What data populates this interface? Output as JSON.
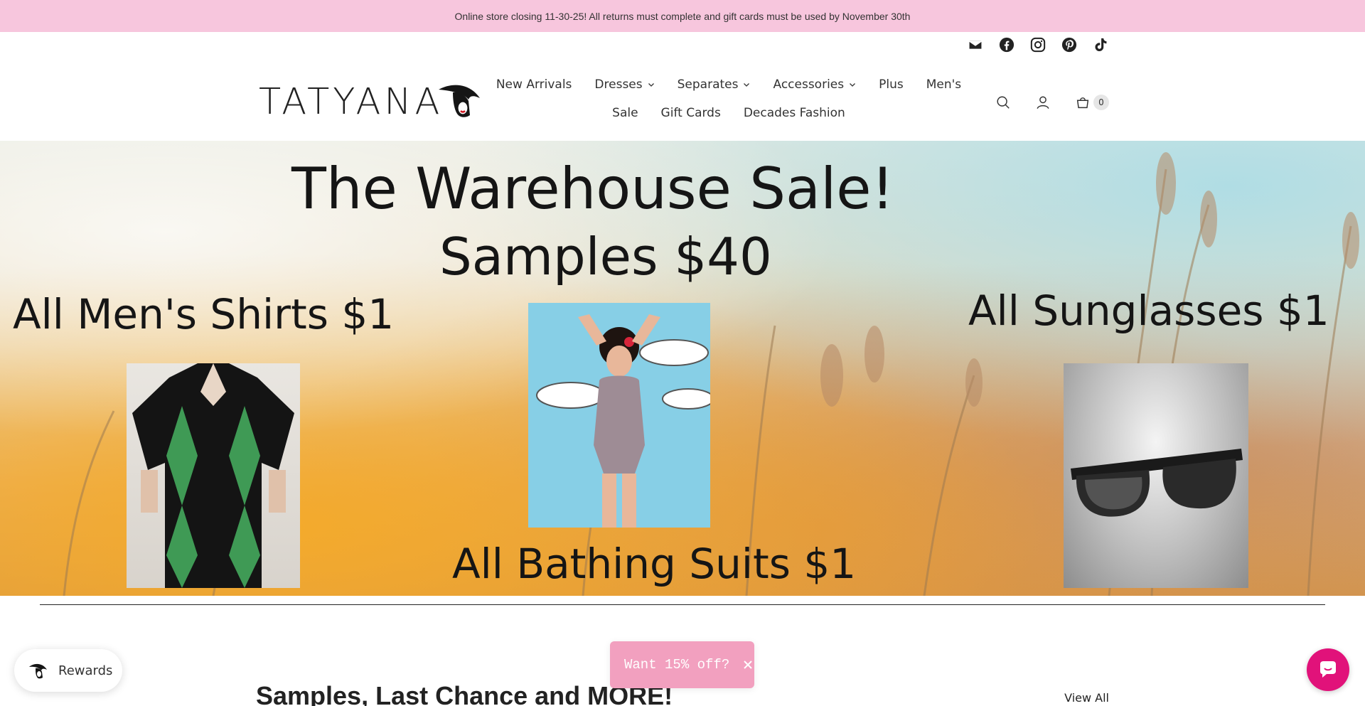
{
  "announcement": {
    "text": "Online store closing 11-30-25! All returns must complete and gift cards must be used by November 30th"
  },
  "social_icons": [
    "mail-icon",
    "facebook-icon",
    "instagram-icon",
    "pinterest-icon",
    "tiktok-icon"
  ],
  "brand": {
    "name": "TATYANA"
  },
  "nav": {
    "row1": [
      {
        "label": "New Arrivals",
        "has_dropdown": false
      },
      {
        "label": "Dresses",
        "has_dropdown": true
      },
      {
        "label": "Separates",
        "has_dropdown": true
      },
      {
        "label": "Accessories",
        "has_dropdown": true
      },
      {
        "label": "Plus",
        "has_dropdown": false
      },
      {
        "label": "Men's",
        "has_dropdown": false
      }
    ],
    "row2": [
      {
        "label": "Sale",
        "has_dropdown": false
      },
      {
        "label": "Gift Cards",
        "has_dropdown": false
      },
      {
        "label": "Decades Fashion",
        "has_dropdown": false
      }
    ]
  },
  "header_icons": {
    "search": "search-icon",
    "account": "account-icon",
    "cart": "cart-icon",
    "cart_count": "0"
  },
  "hero": {
    "headline": "The Warehouse Sale!",
    "subheadline": "Samples $40",
    "left_label": "All Men's Shirts $1",
    "right_label": "All Sunglasses $1",
    "bottom_label": "All Bathing Suits $1"
  },
  "section": {
    "title": "Samples, Last Chance and MORE!",
    "view_all": "View All"
  },
  "rewards": {
    "label": "Rewards"
  },
  "popup": {
    "text": "Want 15% off?"
  },
  "colors": {
    "announcement_bg": "#f7c6dd",
    "popup_bg": "#f2a0bf",
    "chat_bg": "#e1127a"
  }
}
